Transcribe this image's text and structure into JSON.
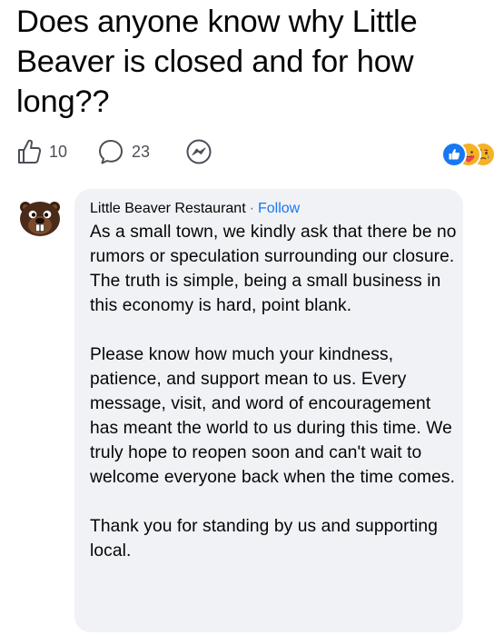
{
  "post": {
    "title": "Does anyone know why Little Beaver is closed and for how long??",
    "like_count": "10",
    "comment_count": "23"
  },
  "icons": {
    "like": "like-icon",
    "comment": "comment-icon",
    "messenger": "messenger-icon",
    "reactions": [
      "like-reaction-icon",
      "care-reaction-icon",
      "sad-reaction-icon"
    ]
  },
  "colors": {
    "link_blue": "#1877f2",
    "bubble_bg": "#f0f2f5",
    "text": "#050505",
    "meta_gray": "#65676b"
  },
  "comment": {
    "author": "Little Beaver Restaurant",
    "separator": "·",
    "follow_label": "Follow",
    "paragraphs": [
      "As a small town, we kindly ask that there be no rumors or speculation surrounding our closure. The truth is simple, being a small business in this economy is hard, point blank.",
      "Please know how much your kindness, patience, and support mean to us. Every message, visit, and word of encouragement has meant the world to us during this time. We truly hope to reopen soon and can't wait to welcome everyone back when the time comes.",
      "Thank you for standing by us and supporting local."
    ]
  }
}
